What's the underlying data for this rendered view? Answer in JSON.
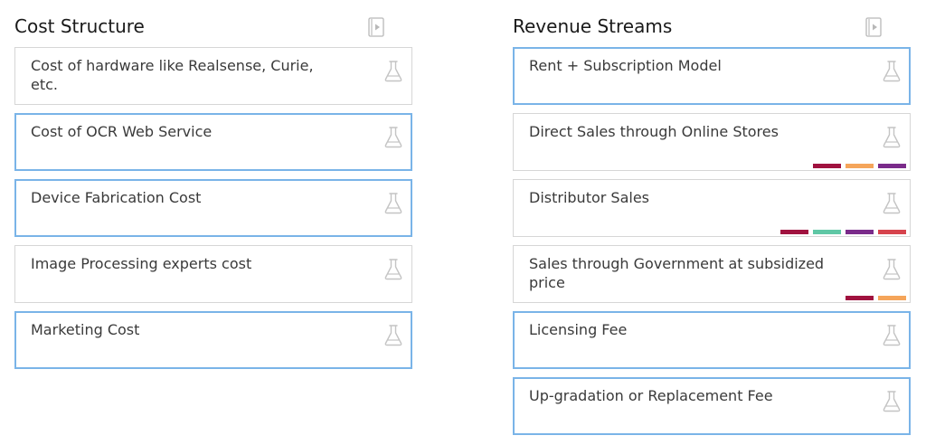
{
  "cost_structure": {
    "title": "Cost Structure",
    "items": [
      {
        "text": "Cost of hardware like Realsense, Curie, etc.",
        "selected": false,
        "tags": []
      },
      {
        "text": "Cost of OCR Web Service",
        "selected": true,
        "tags": []
      },
      {
        "text": "Device Fabrication Cost",
        "selected": true,
        "tags": []
      },
      {
        "text": "Image Processing experts cost",
        "selected": false,
        "tags": []
      },
      {
        "text": "Marketing Cost",
        "selected": true,
        "tags": []
      }
    ]
  },
  "revenue_streams": {
    "title": "Revenue Streams",
    "items": [
      {
        "text": "Rent + Subscription Model",
        "selected": true,
        "tags": []
      },
      {
        "text": "Direct Sales through Online Stores",
        "selected": false,
        "tags": [
          "#a0123f",
          "#f5a55a",
          "#7a2b8a"
        ]
      },
      {
        "text": "Distributor Sales",
        "selected": false,
        "tags": [
          "#a0123f",
          "#5fc7a5",
          "#7a2b8a",
          "#d6434d"
        ]
      },
      {
        "text": "Sales through Government at subsidized price",
        "selected": false,
        "tags": [
          "#a0123f",
          "#f5a55a"
        ]
      },
      {
        "text": "Licensing Fee",
        "selected": true,
        "tags": []
      },
      {
        "text": "Up-gradation or Replacement Fee",
        "selected": true,
        "tags": []
      }
    ]
  },
  "icons": {
    "header_action": "play-document-icon",
    "card_action": "flask-icon"
  },
  "colors": {
    "selected_border": "#7ab4e8",
    "card_border": "#d6d6d6",
    "icon_stroke": "#c4c4c4"
  }
}
